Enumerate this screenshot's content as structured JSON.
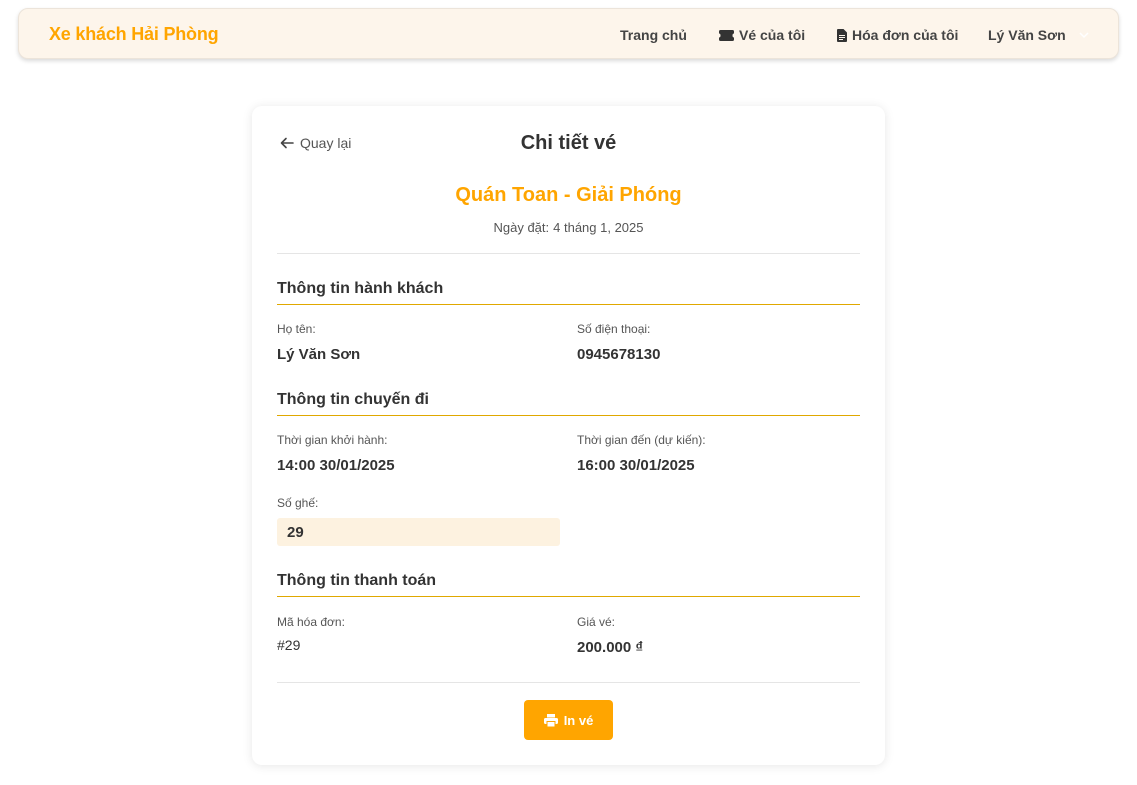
{
  "navbar": {
    "brand": "Xe khách Hải Phòng",
    "home": "Trang chủ",
    "tickets": "Vé của tôi",
    "invoices": "Hóa đơn của tôi",
    "user": "Lý Văn Sơn"
  },
  "ticket": {
    "back": "Quay lại",
    "title": "Chi tiết vé",
    "route": "Quán Toan - Giải Phóng",
    "booked_label": "Ngày đặt:",
    "booked_date": "4 tháng 1, 2025",
    "passenger": {
      "section": "Thông tin hành khách",
      "name_label": "Họ tên:",
      "name": "Lý Văn Sơn",
      "phone_label": "Số điện thoại:",
      "phone": "0945678130"
    },
    "trip": {
      "section": "Thông tin chuyến đi",
      "depart_label": "Thời gian khởi hành:",
      "depart": "14:00 30/01/2025",
      "arrive_label": "Thời gian đến (dự kiến):",
      "arrive": "16:00 30/01/2025",
      "seat_label": "Số ghế:",
      "seat": "29"
    },
    "payment": {
      "section": "Thông tin thanh toán",
      "invoice_label": "Mã hóa đơn:",
      "invoice": "#29",
      "price_label": "Giá vé:",
      "price": "200.000 ₫"
    },
    "print": "In vé"
  },
  "icons": [
    "ticket-icon",
    "document-icon",
    "chevron-down-icon",
    "arrow-left-icon",
    "printer-icon"
  ],
  "colors": {
    "accent": "#ffa500",
    "navbar_bg": "#fdf5eb",
    "seat_bg": "#fdf2e0"
  }
}
